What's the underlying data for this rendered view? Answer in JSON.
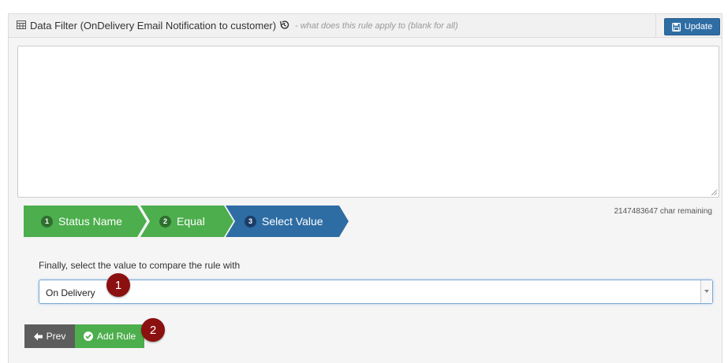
{
  "header": {
    "title": "Data Filter (OnDelivery Email Notification to customer)",
    "hint": "- what does this rule apply to (blank for all)",
    "update_label": "Update",
    "icons": {
      "table": "table-icon",
      "history": "history-icon",
      "save": "save-icon"
    }
  },
  "editor": {
    "value": "",
    "chars_remaining": "2147483647 char remaining"
  },
  "steps": [
    {
      "number": "1",
      "label": "Status Name",
      "state": "complete"
    },
    {
      "number": "2",
      "label": "Equal",
      "state": "complete"
    },
    {
      "number": "3",
      "label": "Select Value",
      "state": "active"
    }
  ],
  "form": {
    "instruction": "Finally, select the value to compare the rule with",
    "selected_value": "On Delivery"
  },
  "actions": {
    "prev_label": "Prev",
    "add_rule_label": "Add Rule"
  },
  "annotations": [
    "1",
    "2"
  ],
  "colors": {
    "primary": "#2e6da4",
    "success": "#4cae4c",
    "secondary": "#5d5d5d",
    "annotation": "#8b1010"
  }
}
